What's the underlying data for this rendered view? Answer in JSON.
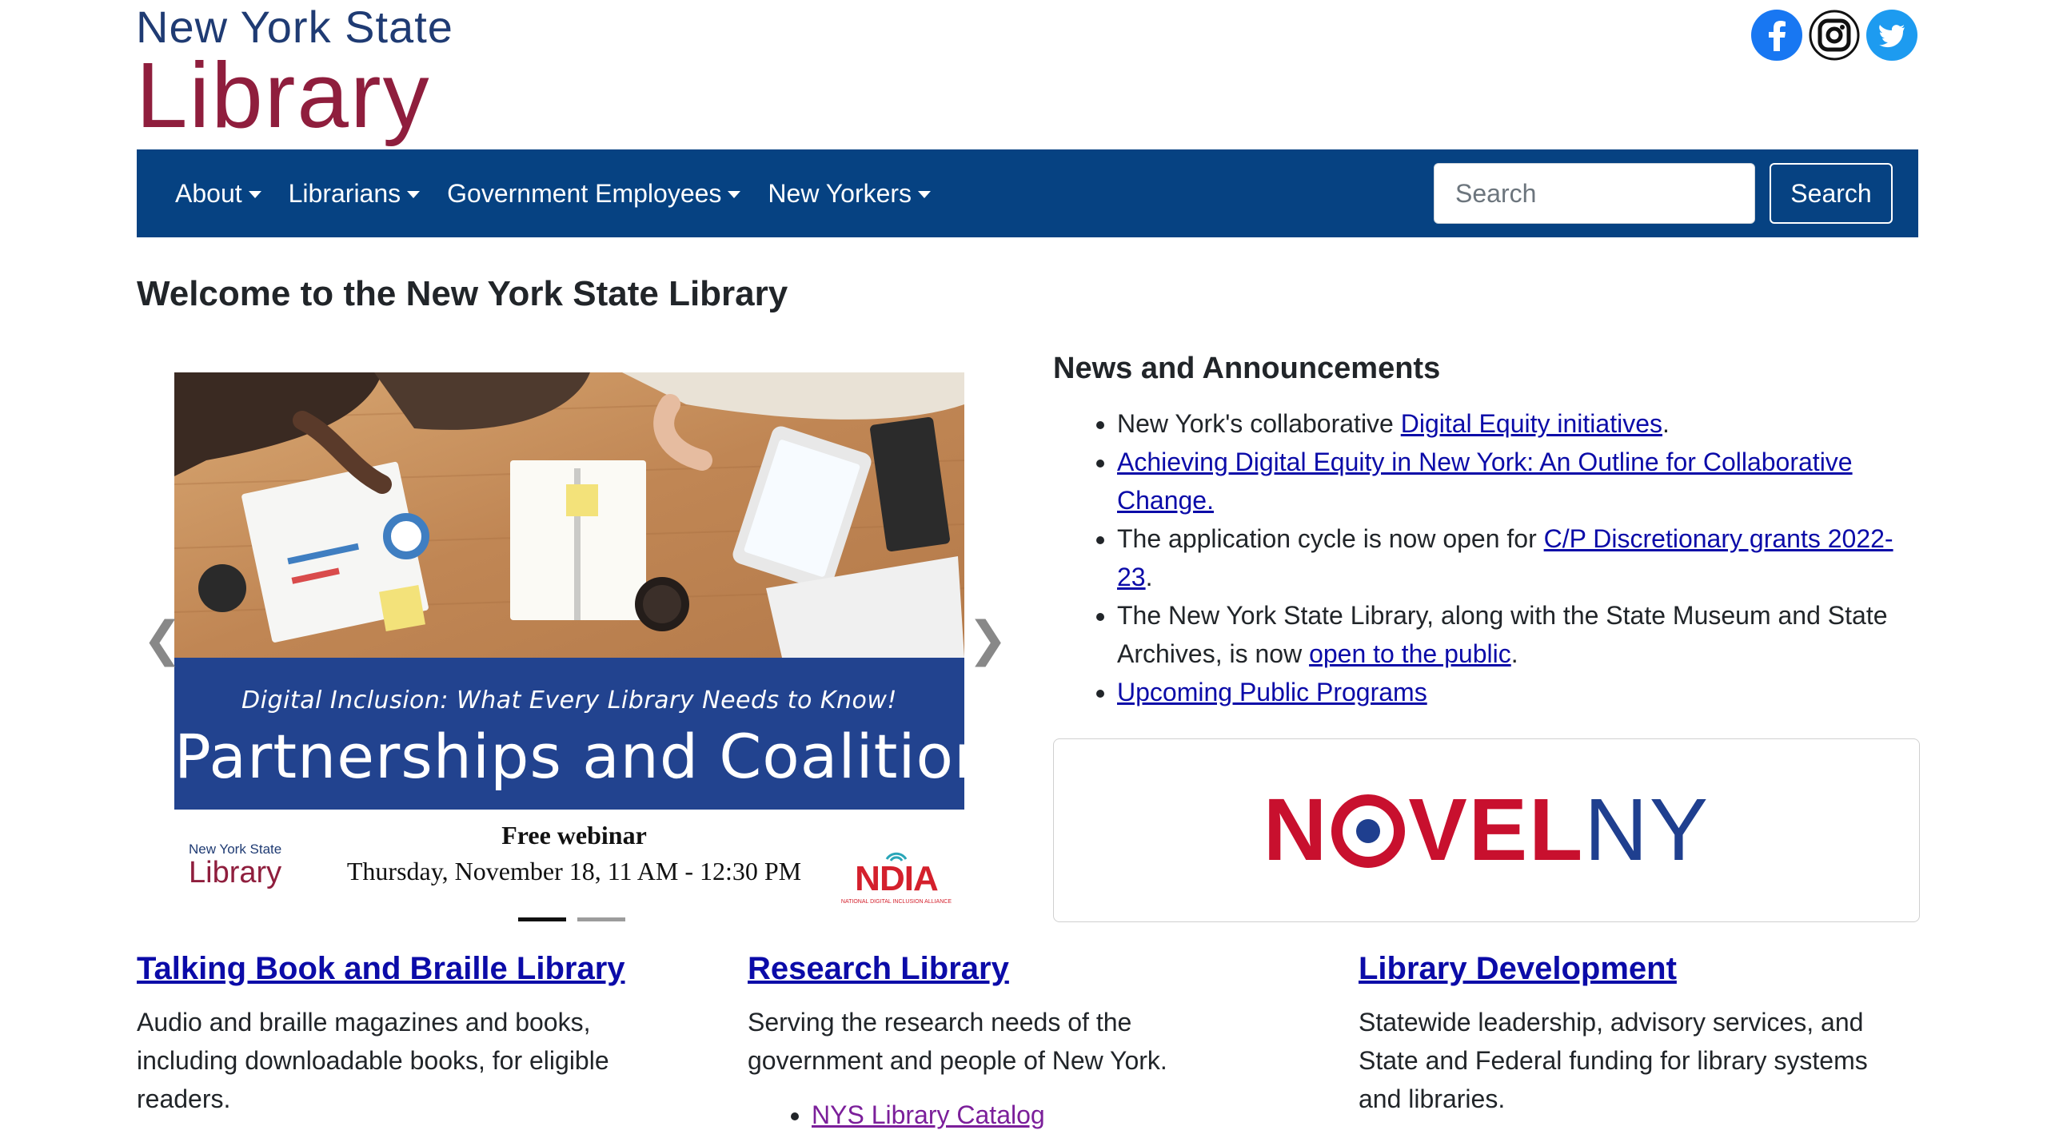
{
  "header": {
    "logo_line1": "New York State",
    "logo_line2": "Library",
    "social": [
      {
        "name": "facebook-icon"
      },
      {
        "name": "instagram-icon"
      },
      {
        "name": "twitter-icon"
      }
    ]
  },
  "nav": {
    "items": [
      {
        "label": "About"
      },
      {
        "label": "Librarians"
      },
      {
        "label": "Government Employees"
      },
      {
        "label": "New Yorkers"
      }
    ],
    "search_placeholder": "Search",
    "search_button": "Search"
  },
  "main": {
    "title": "Welcome to the New York State Library"
  },
  "carousel": {
    "subtitle": "Digital Inclusion: What Every Library Needs to Know!",
    "headline": "Partnerships and Coalitions",
    "mini_logo_line1": "New York State",
    "mini_logo_line2": "Library",
    "webinar_title": "Free webinar",
    "webinar_date": "Thursday, November 18, 11 AM - 12:30 PM",
    "partner_logo": "NDIA",
    "partner_tagline": "NATIONAL DIGITAL INCLUSION ALLIANCE",
    "prev_glyph": "❮",
    "next_glyph": "❯"
  },
  "news": {
    "title": "News and Announcements",
    "items": [
      {
        "before": "New York's collaborative ",
        "link": "Digital Equity initiatives",
        "after": "."
      },
      {
        "before": "",
        "link": "Achieving Digital Equity in New York: An Outline for Collaborative Change.",
        "after": ""
      },
      {
        "before": "The application cycle is now open for ",
        "link": "C/P Discretionary grants 2022-23",
        "after": "."
      },
      {
        "before": "The New York State Library, along with the State Museum and State Archives, is now ",
        "link": "open to the public",
        "after": "."
      },
      {
        "before": "",
        "link": "Upcoming Public Programs",
        "after": ""
      }
    ],
    "novel_n": "N",
    "novel_vel": "VEL",
    "novel_ny": "NY"
  },
  "columns": [
    {
      "title": "Talking Book and Braille Library",
      "text": "Audio and braille magazines and books, including downloadable books, for eligible readers."
    },
    {
      "title": "Research Library",
      "text": "Serving the research needs of the government and people of New York.",
      "link": "NYS Library Catalog"
    },
    {
      "title": "Library Development",
      "text": "Statewide leadership, advisory services, and State and Federal funding for library systems and libraries."
    }
  ]
}
